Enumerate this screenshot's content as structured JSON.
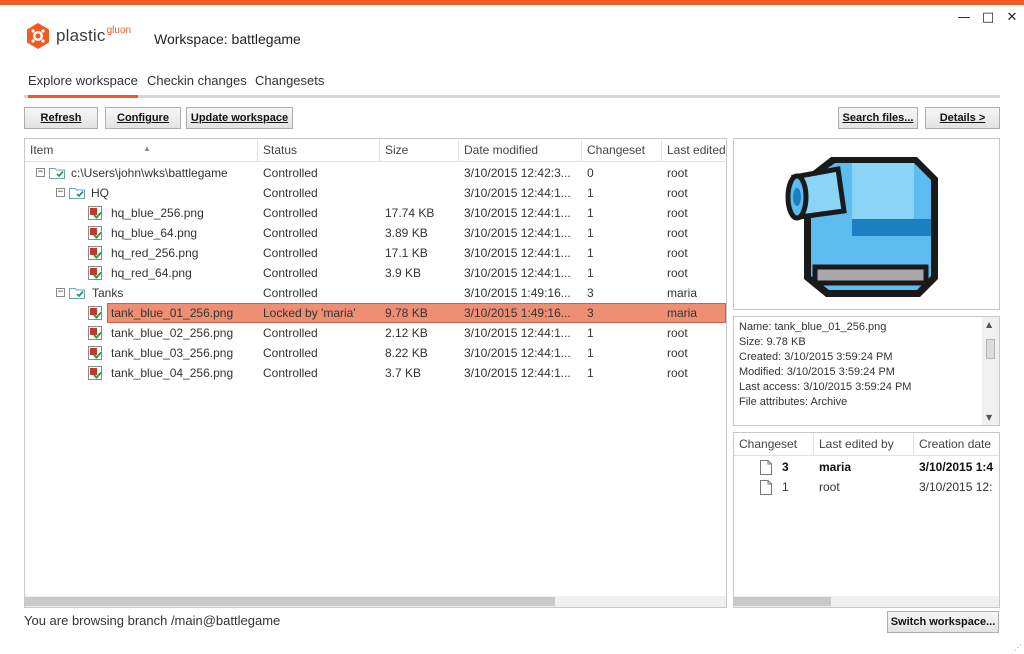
{
  "app": {
    "logo_text": "plastic",
    "logo_sub": "gluon",
    "title": "Workspace: battlegame"
  },
  "window": {
    "minimize": "—",
    "maximize": "□",
    "close": "✕"
  },
  "tabs": [
    "Explore workspace",
    "Checkin changes",
    "Changesets"
  ],
  "toolbar": {
    "refresh": "Refresh",
    "configure": "Configure",
    "update": "Update workspace",
    "search": "Search files...",
    "details": "Details >"
  },
  "grid": {
    "columns": [
      "Item",
      "Status",
      "Size",
      "Date modified",
      "Changeset",
      "Last edited"
    ],
    "rows": [
      {
        "name": "c:\\Users\\john\\wks\\battlegame",
        "status": "Controlled",
        "size": "",
        "date": "3/10/2015 12:42:3...",
        "cs": "0",
        "user": "root"
      },
      {
        "name": "HQ",
        "status": "Controlled",
        "size": "",
        "date": "3/10/2015 12:44:1...",
        "cs": "1",
        "user": "root"
      },
      {
        "name": "hq_blue_256.png",
        "status": "Controlled",
        "size": "17.74 KB",
        "date": "3/10/2015 12:44:1...",
        "cs": "1",
        "user": "root"
      },
      {
        "name": "hq_blue_64.png",
        "status": "Controlled",
        "size": "3.89 KB",
        "date": "3/10/2015 12:44:1...",
        "cs": "1",
        "user": "root"
      },
      {
        "name": "hq_red_256.png",
        "status": "Controlled",
        "size": "17.1 KB",
        "date": "3/10/2015 12:44:1...",
        "cs": "1",
        "user": "root"
      },
      {
        "name": "hq_red_64.png",
        "status": "Controlled",
        "size": "3.9 KB",
        "date": "3/10/2015 12:44:1...",
        "cs": "1",
        "user": "root"
      },
      {
        "name": "Tanks",
        "status": "Controlled",
        "size": "",
        "date": "3/10/2015 1:49:16...",
        "cs": "3",
        "user": "maria"
      },
      {
        "name": "tank_blue_01_256.png",
        "status": "Locked by 'maria'",
        "size": "9.78 KB",
        "date": "3/10/2015 1:49:16...",
        "cs": "3",
        "user": "maria"
      },
      {
        "name": "tank_blue_02_256.png",
        "status": "Controlled",
        "size": "2.12 KB",
        "date": "3/10/2015 12:44:1...",
        "cs": "1",
        "user": "root"
      },
      {
        "name": "tank_blue_03_256.png",
        "status": "Controlled",
        "size": "8.22 KB",
        "date": "3/10/2015 12:44:1...",
        "cs": "1",
        "user": "root"
      },
      {
        "name": "tank_blue_04_256.png",
        "status": "Controlled",
        "size": "3.7 KB",
        "date": "3/10/2015 12:44:1...",
        "cs": "1",
        "user": "root"
      }
    ]
  },
  "info": {
    "lines": [
      "Name: tank_blue_01_256.png",
      "Size: 9.78 KB",
      "Created: 3/10/2015 3:59:24 PM",
      "Modified: 3/10/2015 3:59:24 PM",
      "Last access: 3/10/2015 3:59:24 PM",
      "File attributes: Archive"
    ]
  },
  "history": {
    "columns": [
      "Changeset",
      "Last edited by",
      "Creation date"
    ],
    "rows": [
      {
        "cs": "3",
        "user": "maria",
        "date": "3/10/2015 1:4"
      },
      {
        "cs": "1",
        "user": "root",
        "date": "3/10/2015 12:"
      }
    ]
  },
  "status": {
    "text": "You are browsing branch /main@battlegame",
    "switch": "Switch workspace..."
  },
  "colors": {
    "accent": "#f15a24",
    "selection": "#ee8f74"
  }
}
